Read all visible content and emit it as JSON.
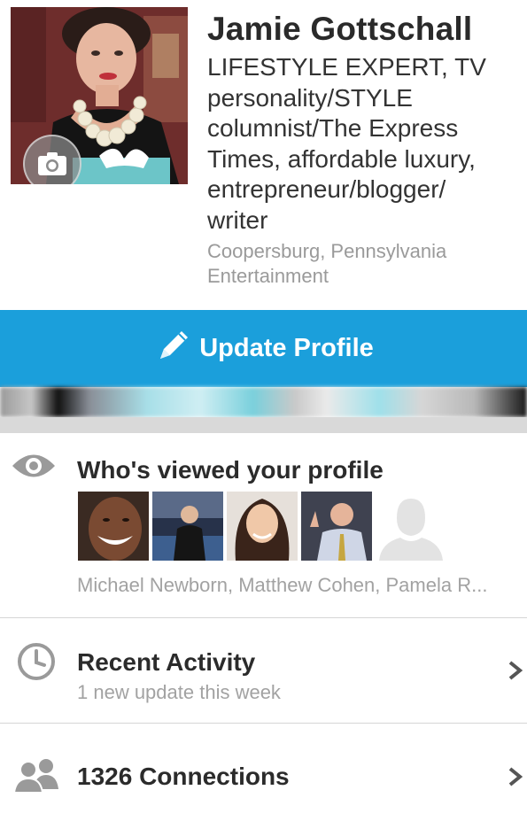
{
  "profile": {
    "name": "Jamie Gottschall",
    "headline": "LIFESTYLE EXPERT, TV personality/STYLE columnist/The Express Times, affordable luxury, entrepreneur/blogger/ writer",
    "location": "Coopersburg, Pennsylvania",
    "industry": "Entertainment"
  },
  "update_button": {
    "label": "Update Profile"
  },
  "viewed": {
    "title": "Who's viewed your profile",
    "viewers_text": "Michael Newborn, Matthew Cohen, Pamela R..."
  },
  "recent_activity": {
    "title": "Recent Activity",
    "subtitle": "1 new update this week"
  },
  "connections": {
    "title": "1326 Connections"
  },
  "colors": {
    "accent": "#1b9fdb",
    "text_primary": "#2b2b2b",
    "text_secondary": "#a2a2a2",
    "divider": "#d6d6d6"
  },
  "icons": {
    "camera": "camera-icon",
    "pencil": "pencil-icon",
    "eye": "eye-icon",
    "clock": "clock-icon",
    "people": "people-icon",
    "chevron": "chevron-right-icon"
  }
}
